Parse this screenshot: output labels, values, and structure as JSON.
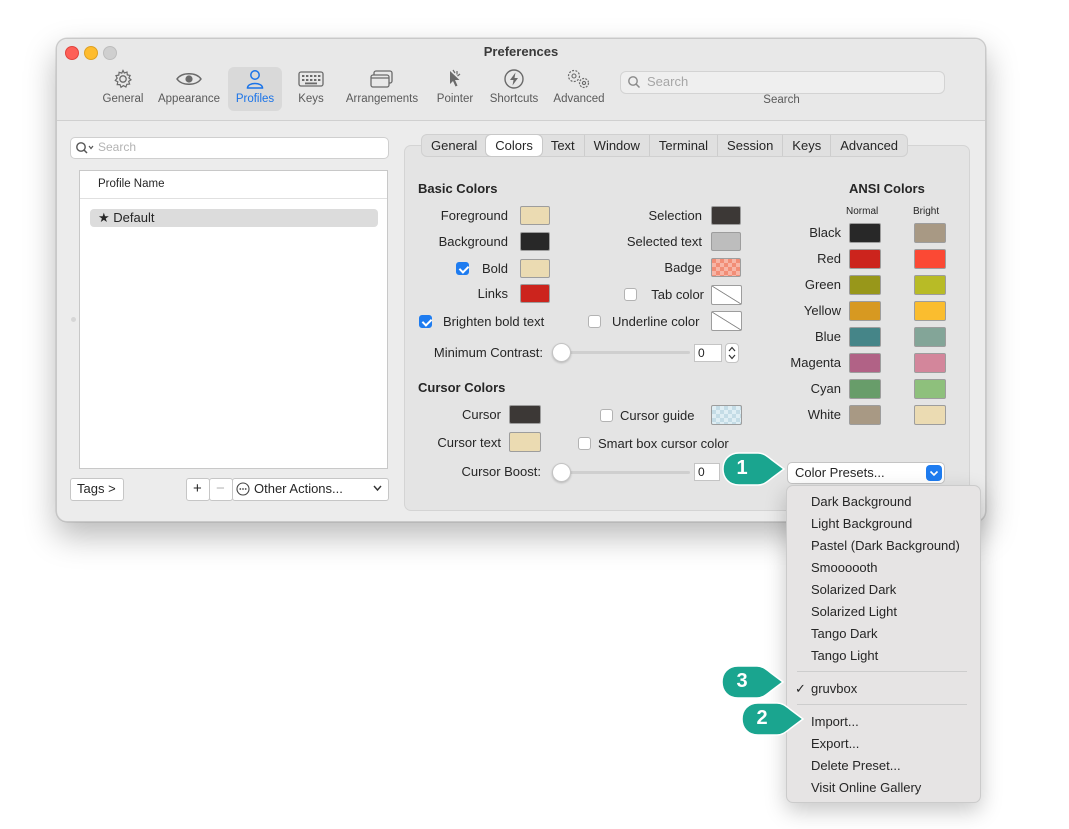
{
  "window": {
    "title": "Preferences"
  },
  "toolbar": {
    "items": [
      {
        "label": "General",
        "icon": "gear-icon"
      },
      {
        "label": "Appearance",
        "icon": "eye-icon"
      },
      {
        "label": "Profiles",
        "icon": "person-icon",
        "active": true
      },
      {
        "label": "Keys",
        "icon": "keyboard-icon"
      },
      {
        "label": "Arrangements",
        "icon": "windows-icon"
      },
      {
        "label": "Pointer",
        "icon": "pointer-icon"
      },
      {
        "label": "Shortcuts",
        "icon": "lightning-icon"
      },
      {
        "label": "Advanced",
        "icon": "gears-icon"
      }
    ],
    "search_placeholder": "Search",
    "search_label": "Search"
  },
  "sidebar": {
    "search_placeholder": "Search",
    "column_header": "Profile Name",
    "profiles": [
      {
        "name": "Default",
        "icon": "star-icon"
      }
    ],
    "tags_button": "Tags >",
    "add": "+",
    "remove": "−",
    "other_actions": "Other Actions..."
  },
  "tabs": [
    "General",
    "Colors",
    "Text",
    "Window",
    "Terminal",
    "Session",
    "Keys",
    "Advanced"
  ],
  "selected_tab": "Colors",
  "basic": {
    "heading": "Basic Colors",
    "foreground": "Foreground",
    "background": "Background",
    "bold": "Bold",
    "links": "Links",
    "selection": "Selection",
    "selected_text": "Selected text",
    "badge": "Badge",
    "tab_color": "Tab color",
    "brighten": "Brighten bold text",
    "underline": "Underline color",
    "min_contrast": "Minimum Contrast:",
    "min_contrast_value": "0",
    "colors": {
      "foreground": "#ebdbb2",
      "background": "#282828",
      "bold": "#ebdbb2",
      "links": "#cc241d",
      "selection": "#3c3836",
      "selected_text": "#bdbdbd",
      "badge": "#f28d76"
    }
  },
  "cursor": {
    "heading": "Cursor Colors",
    "cursor": "Cursor",
    "cursor_text": "Cursor text",
    "cursor_guide": "Cursor guide",
    "smart_box": "Smart box cursor color",
    "boost": "Cursor Boost:",
    "boost_value": "0",
    "colors": {
      "cursor": "#3c3836",
      "cursor_text": "#ebdbb2"
    }
  },
  "ansi": {
    "heading": "ANSI Colors",
    "normal": "Normal",
    "bright": "Bright",
    "rows": [
      {
        "name": "Black",
        "normal": "#282828",
        "bright": "#a89984"
      },
      {
        "name": "Red",
        "normal": "#cc241d",
        "bright": "#fb4934"
      },
      {
        "name": "Green",
        "normal": "#98971a",
        "bright": "#b8bb26"
      },
      {
        "name": "Yellow",
        "normal": "#d79921",
        "bright": "#fabd2f"
      },
      {
        "name": "Blue",
        "normal": "#458588",
        "bright": "#83a598"
      },
      {
        "name": "Magenta",
        "normal": "#b16286",
        "bright": "#d3869b"
      },
      {
        "name": "Cyan",
        "normal": "#689d6a",
        "bright": "#8ec07c"
      },
      {
        "name": "White",
        "normal": "#a89984",
        "bright": "#ebdbb2"
      }
    ]
  },
  "presets_button": "Color Presets...",
  "menu": {
    "group1": [
      "Dark Background",
      "Light Background",
      "Pastel (Dark Background)",
      "Smoooooth",
      "Solarized Dark",
      "Solarized Light",
      "Tango Dark",
      "Tango Light"
    ],
    "checked": "gruvbox",
    "group3": [
      "Import...",
      "Export...",
      "Delete Preset...",
      "Visit Online Gallery"
    ]
  },
  "callouts": [
    "1",
    "2",
    "3"
  ],
  "accent": "#1e7cf0",
  "callout_color": "#1aa58f"
}
